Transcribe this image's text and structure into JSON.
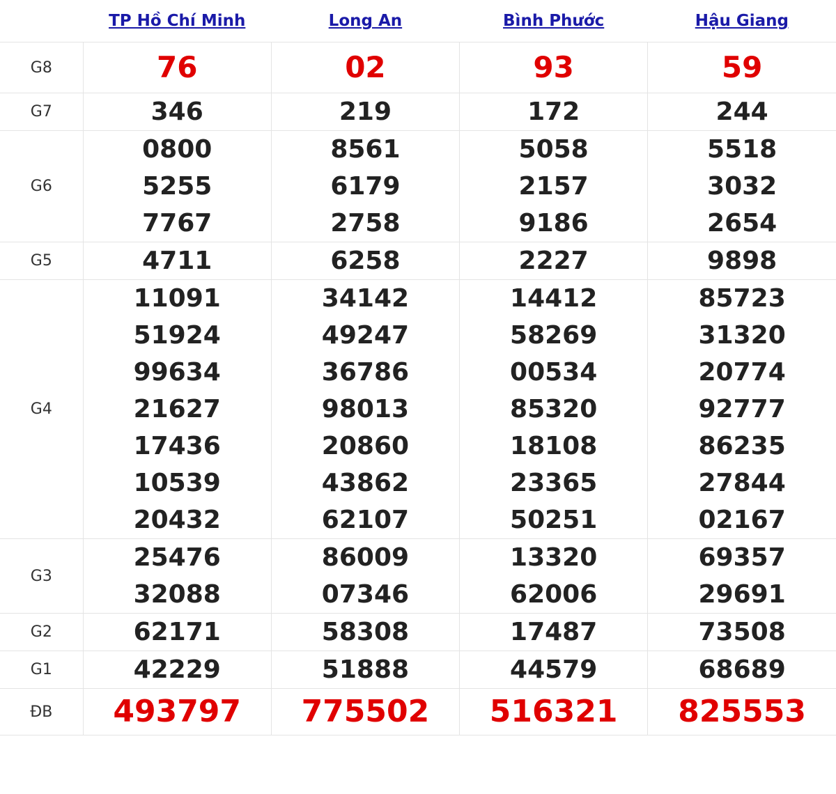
{
  "header": {
    "provinces": [
      "TP Hồ Chí Minh",
      "Long An",
      "Bình Phước",
      "Hậu Giang"
    ]
  },
  "colors": {
    "link": "#1a1aa8",
    "highlight": "#e00000",
    "text": "#222222",
    "border": "#e4e4e4"
  },
  "rows": [
    {
      "label": "G8",
      "values": [
        [
          "76"
        ],
        [
          "02"
        ],
        [
          "93"
        ],
        [
          "59"
        ]
      ]
    },
    {
      "label": "G7",
      "values": [
        [
          "346"
        ],
        [
          "219"
        ],
        [
          "172"
        ],
        [
          "244"
        ]
      ]
    },
    {
      "label": "G6",
      "values": [
        [
          "0800",
          "5255",
          "7767"
        ],
        [
          "8561",
          "6179",
          "2758"
        ],
        [
          "5058",
          "2157",
          "9186"
        ],
        [
          "5518",
          "3032",
          "2654"
        ]
      ]
    },
    {
      "label": "G5",
      "values": [
        [
          "4711"
        ],
        [
          "6258"
        ],
        [
          "2227"
        ],
        [
          "9898"
        ]
      ]
    },
    {
      "label": "G4",
      "values": [
        [
          "11091",
          "51924",
          "99634",
          "21627",
          "17436",
          "10539",
          "20432"
        ],
        [
          "34142",
          "49247",
          "36786",
          "98013",
          "20860",
          "43862",
          "62107"
        ],
        [
          "14412",
          "58269",
          "00534",
          "85320",
          "18108",
          "23365",
          "50251"
        ],
        [
          "85723",
          "31320",
          "20774",
          "92777",
          "86235",
          "27844",
          "02167"
        ]
      ]
    },
    {
      "label": "G3",
      "values": [
        [
          "25476",
          "32088"
        ],
        [
          "86009",
          "07346"
        ],
        [
          "13320",
          "62006"
        ],
        [
          "69357",
          "29691"
        ]
      ]
    },
    {
      "label": "G2",
      "values": [
        [
          "62171"
        ],
        [
          "58308"
        ],
        [
          "17487"
        ],
        [
          "73508"
        ]
      ]
    },
    {
      "label": "G1",
      "values": [
        [
          "42229"
        ],
        [
          "51888"
        ],
        [
          "44579"
        ],
        [
          "68689"
        ]
      ]
    },
    {
      "label": "ĐB",
      "values": [
        [
          "493797"
        ],
        [
          "775502"
        ],
        [
          "516321"
        ],
        [
          "825553"
        ]
      ]
    }
  ]
}
